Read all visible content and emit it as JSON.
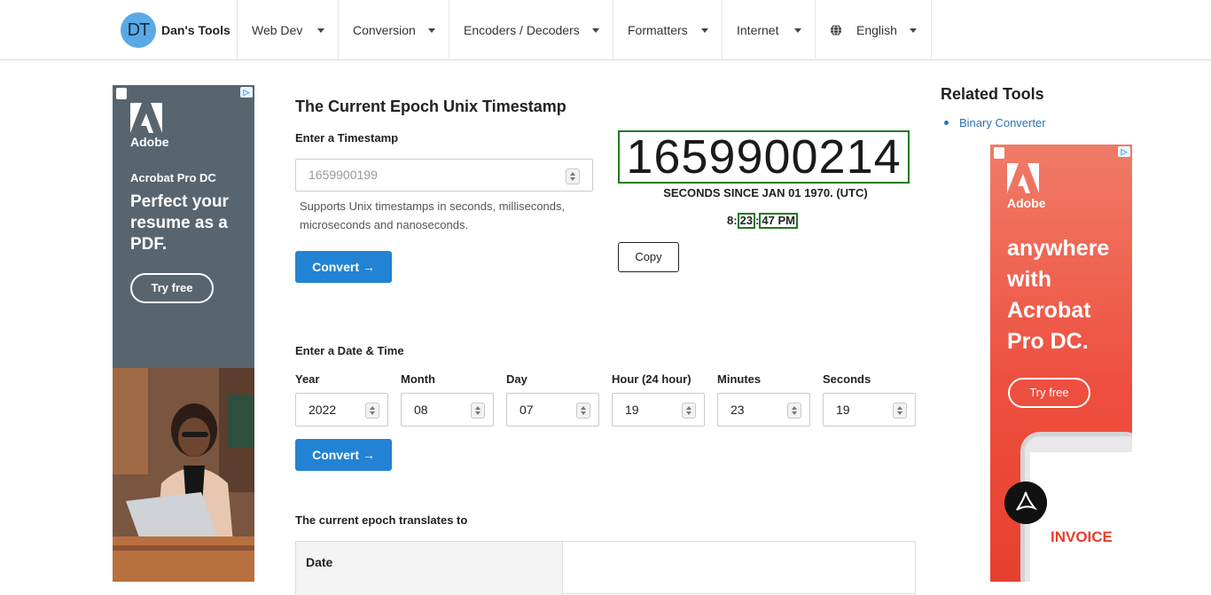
{
  "brand": {
    "initials": "DT",
    "name": "Dan's Tools"
  },
  "nav": [
    {
      "label": "Web Dev"
    },
    {
      "label": "Conversion"
    },
    {
      "label": "Encoders / Decoders"
    },
    {
      "label": "Formatters"
    },
    {
      "label": "Internet"
    },
    {
      "label": "English"
    }
  ],
  "main": {
    "title": "The Current Epoch Unix Timestamp",
    "timestamp_label": "Enter a Timestamp",
    "timestamp_placeholder": "1659900199",
    "hint": "Supports Unix timestamps in seconds, milliseconds, microseconds and nanoseconds.",
    "convert_label": "Convert →",
    "epoch": "1659900214",
    "since_label": "SECONDS SINCE JAN 01 1970. (UTC)",
    "clock": {
      "hour": "8",
      "sep1": ":",
      "minute": "23",
      "sep2": ":",
      "second_ampm": "47 PM"
    },
    "copy_label": "Copy",
    "datetime_label": "Enter a Date & Time",
    "fields": [
      {
        "label": "Year",
        "value": "2022"
      },
      {
        "label": "Month",
        "value": "08"
      },
      {
        "label": "Day",
        "value": "07"
      },
      {
        "label": "Hour (24 hour)",
        "value": "19"
      },
      {
        "label": "Minutes",
        "value": "23"
      },
      {
        "label": "Seconds",
        "value": "19"
      }
    ],
    "translates_label": "The current epoch translates to",
    "table": {
      "row1_key": "Date"
    }
  },
  "related": {
    "title": "Related Tools",
    "items": [
      "Binary Converter"
    ]
  },
  "ads": {
    "left": {
      "brand": "Adobe",
      "product": "Acrobat Pro DC",
      "headline": "Perfect your resume as a PDF.",
      "cta": "Try free"
    },
    "right": {
      "brand": "Adobe",
      "headline": "anywhere with Acrobat Pro DC.",
      "cta": "Try free",
      "invoice": "INVOICE"
    }
  },
  "colors": {
    "accent": "#2283d4",
    "highlight_border": "#1d7a1d",
    "link": "#2a72b8"
  }
}
